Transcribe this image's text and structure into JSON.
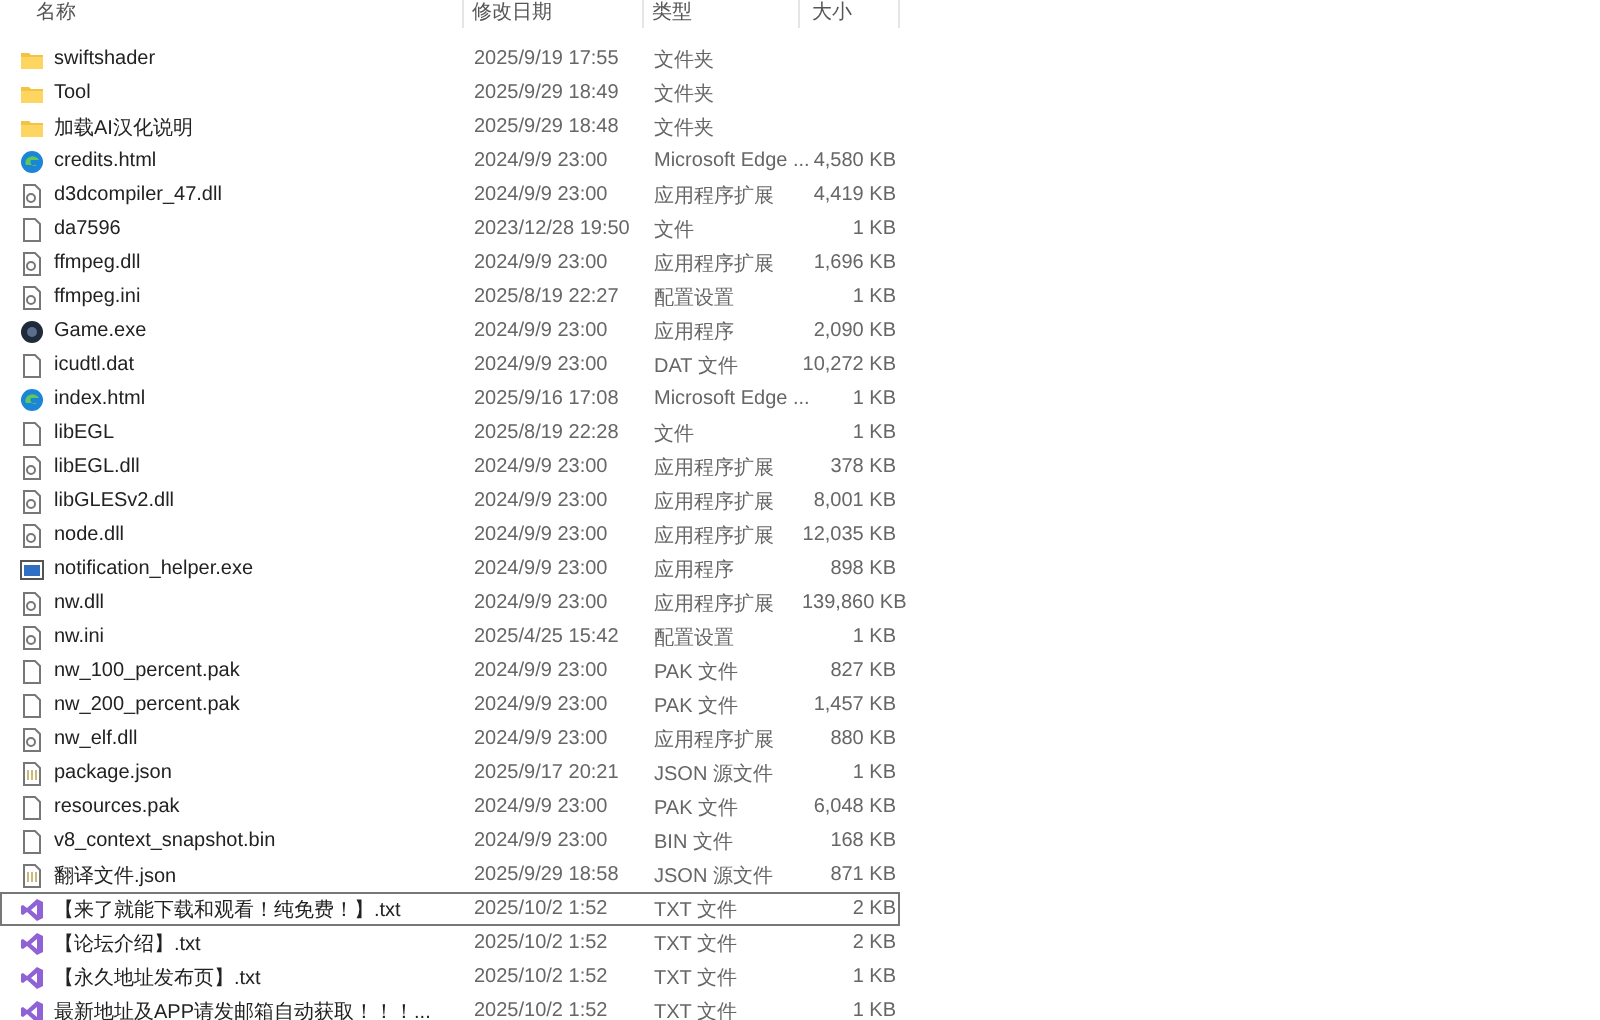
{
  "columns": [
    "名称",
    "修改日期",
    "类型",
    "大小"
  ],
  "rows": [
    {
      "name": "swiftshader",
      "date": "2025/9/19 17:55",
      "type": "文件夹",
      "size": "",
      "kind": "folder",
      "selected": false
    },
    {
      "name": "Tool",
      "date": "2025/9/29 18:49",
      "type": "文件夹",
      "size": "",
      "kind": "folder",
      "selected": false
    },
    {
      "name": "加载AI汉化说明",
      "date": "2025/9/29 18:48",
      "type": "文件夹",
      "size": "",
      "kind": "folder",
      "selected": false
    },
    {
      "name": "credits.html",
      "date": "2024/9/9 23:00",
      "type": "Microsoft Edge ...",
      "size": "4,580 KB",
      "kind": "edge",
      "selected": false
    },
    {
      "name": "d3dcompiler_47.dll",
      "date": "2024/9/9 23:00",
      "type": "应用程序扩展",
      "size": "4,419 KB",
      "kind": "dll",
      "selected": false
    },
    {
      "name": "da7596",
      "date": "2023/12/28 19:50",
      "type": "文件",
      "size": "1 KB",
      "kind": "file",
      "selected": false
    },
    {
      "name": "ffmpeg.dll",
      "date": "2024/9/9 23:00",
      "type": "应用程序扩展",
      "size": "1,696 KB",
      "kind": "dll",
      "selected": false
    },
    {
      "name": "ffmpeg.ini",
      "date": "2025/8/19 22:27",
      "type": "配置设置",
      "size": "1 KB",
      "kind": "ini",
      "selected": false
    },
    {
      "name": "Game.exe",
      "date": "2024/9/9 23:00",
      "type": "应用程序",
      "size": "2,090 KB",
      "kind": "game",
      "selected": false
    },
    {
      "name": "icudtl.dat",
      "date": "2024/9/9 23:00",
      "type": "DAT 文件",
      "size": "10,272 KB",
      "kind": "file",
      "selected": false
    },
    {
      "name": "index.html",
      "date": "2025/9/16 17:08",
      "type": "Microsoft Edge ...",
      "size": "1 KB",
      "kind": "edge",
      "selected": false
    },
    {
      "name": "libEGL",
      "date": "2025/8/19 22:28",
      "type": "文件",
      "size": "1 KB",
      "kind": "file",
      "selected": false
    },
    {
      "name": "libEGL.dll",
      "date": "2024/9/9 23:00",
      "type": "应用程序扩展",
      "size": "378 KB",
      "kind": "dll",
      "selected": false
    },
    {
      "name": "libGLESv2.dll",
      "date": "2024/9/9 23:00",
      "type": "应用程序扩展",
      "size": "8,001 KB",
      "kind": "dll",
      "selected": false
    },
    {
      "name": "node.dll",
      "date": "2024/9/9 23:00",
      "type": "应用程序扩展",
      "size": "12,035 KB",
      "kind": "dll",
      "selected": false
    },
    {
      "name": "notification_helper.exe",
      "date": "2024/9/9 23:00",
      "type": "应用程序",
      "size": "898 KB",
      "kind": "app",
      "selected": false
    },
    {
      "name": "nw.dll",
      "date": "2024/9/9 23:00",
      "type": "应用程序扩展",
      "size": "139,860 KB",
      "kind": "dll",
      "selected": false
    },
    {
      "name": "nw.ini",
      "date": "2025/4/25 15:42",
      "type": "配置设置",
      "size": "1 KB",
      "kind": "ini",
      "selected": false
    },
    {
      "name": "nw_100_percent.pak",
      "date": "2024/9/9 23:00",
      "type": "PAK 文件",
      "size": "827 KB",
      "kind": "file",
      "selected": false
    },
    {
      "name": "nw_200_percent.pak",
      "date": "2024/9/9 23:00",
      "type": "PAK 文件",
      "size": "1,457 KB",
      "kind": "file",
      "selected": false
    },
    {
      "name": "nw_elf.dll",
      "date": "2024/9/9 23:00",
      "type": "应用程序扩展",
      "size": "880 KB",
      "kind": "dll",
      "selected": false
    },
    {
      "name": "package.json",
      "date": "2025/9/17 20:21",
      "type": "JSON 源文件",
      "size": "1 KB",
      "kind": "json",
      "selected": false
    },
    {
      "name": "resources.pak",
      "date": "2024/9/9 23:00",
      "type": "PAK 文件",
      "size": "6,048 KB",
      "kind": "file",
      "selected": false
    },
    {
      "name": "v8_context_snapshot.bin",
      "date": "2024/9/9 23:00",
      "type": "BIN 文件",
      "size": "168 KB",
      "kind": "file",
      "selected": false
    },
    {
      "name": "翻译文件.json",
      "date": "2025/9/29 18:58",
      "type": "JSON 源文件",
      "size": "871 KB",
      "kind": "json",
      "selected": false
    },
    {
      "name": "【来了就能下载和观看！纯免费！】.txt",
      "date": "2025/10/2 1:52",
      "type": "TXT 文件",
      "size": "2 KB",
      "kind": "vs",
      "selected": true
    },
    {
      "name": "【论坛介绍】.txt",
      "date": "2025/10/2 1:52",
      "type": "TXT 文件",
      "size": "2 KB",
      "kind": "vs",
      "selected": false
    },
    {
      "name": "【永久地址发布页】.txt",
      "date": "2025/10/2 1:52",
      "type": "TXT 文件",
      "size": "1 KB",
      "kind": "vs",
      "selected": false
    },
    {
      "name": "最新地址及APP请发邮箱自动获取！！！...",
      "date": "2025/10/2 1:52",
      "type": "TXT 文件",
      "size": "1 KB",
      "kind": "vs",
      "selected": false
    }
  ]
}
